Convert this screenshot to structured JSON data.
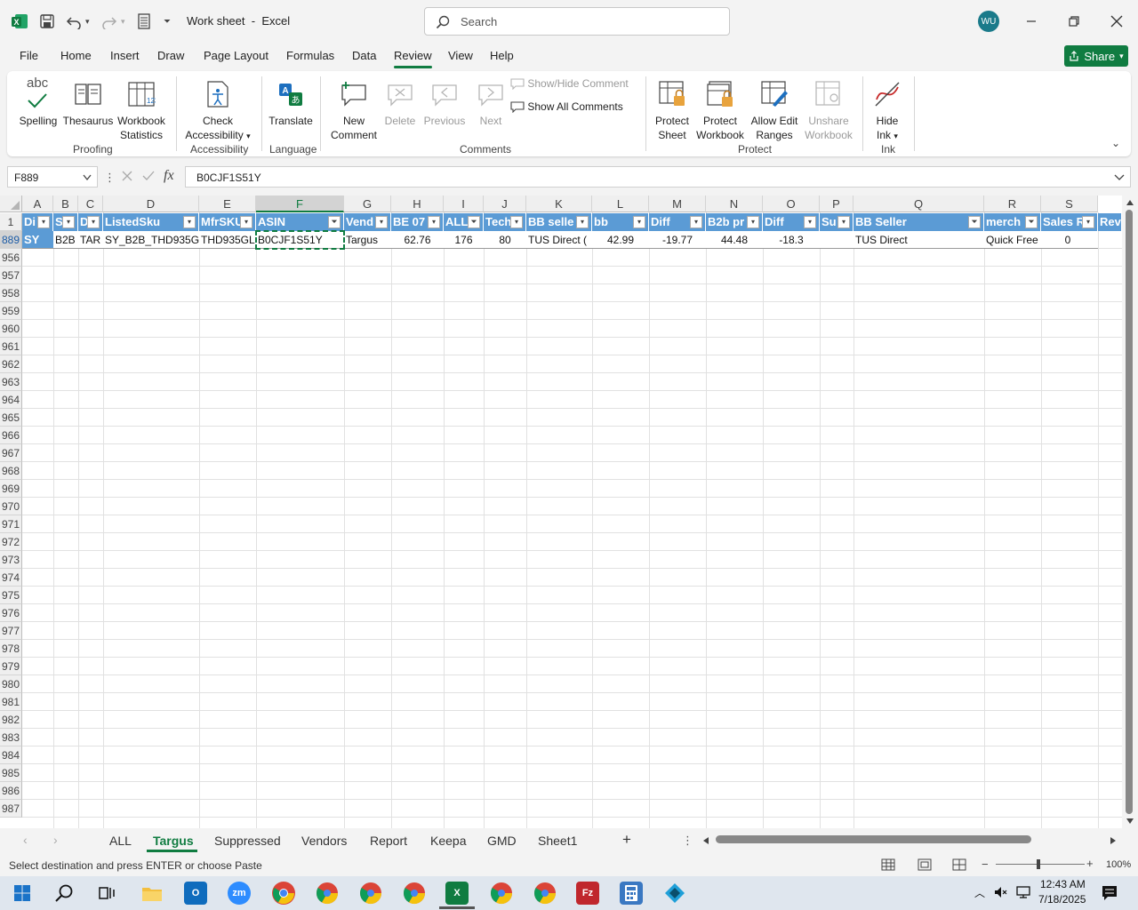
{
  "title_bar": {
    "doc_title": "Work sheet",
    "separator": "-",
    "app_name": "Excel",
    "search_placeholder": "Search",
    "avatar_initials": "WU"
  },
  "menu": {
    "items": [
      "File",
      "Home",
      "Insert",
      "Draw",
      "Page Layout",
      "Formulas",
      "Data",
      "Review",
      "View",
      "Help"
    ],
    "active": "Review",
    "share_label": "Share"
  },
  "ribbon": {
    "proofing": {
      "label": "Proofing",
      "spelling": "Spelling",
      "thesaurus": "Thesaurus",
      "workbook_stats_1": "Workbook",
      "workbook_stats_2": "Statistics",
      "abc": "abc"
    },
    "accessibility": {
      "label": "Accessibility",
      "check_1": "Check",
      "check_2": "Accessibility"
    },
    "language": {
      "label": "Language",
      "translate": "Translate"
    },
    "comments": {
      "label": "Comments",
      "new_1": "New",
      "new_2": "Comment",
      "delete": "Delete",
      "previous": "Previous",
      "next": "Next",
      "show_hide": "Show/Hide Comment",
      "show_all": "Show All Comments"
    },
    "protect": {
      "label": "Protect",
      "sheet_1": "Protect",
      "sheet_2": "Sheet",
      "wb_1": "Protect",
      "wb_2": "Workbook",
      "edit_1": "Allow Edit",
      "edit_2": "Ranges",
      "unshare_1": "Unshare",
      "unshare_2": "Workbook"
    },
    "ink": {
      "label": "Ink",
      "hide_1": "Hide",
      "hide_2": "Ink"
    }
  },
  "formula_bar": {
    "name_box": "F889",
    "fx": "fx",
    "value": "B0CJF1S51Y"
  },
  "grid": {
    "columns": [
      "A",
      "B",
      "C",
      "D",
      "E",
      "F",
      "G",
      "H",
      "I",
      "J",
      "K",
      "L",
      "M",
      "N",
      "O",
      "P",
      "Q",
      "R",
      "S"
    ],
    "selected_column": "F",
    "header_row_number": "1",
    "headers": [
      "Di",
      "S",
      "D",
      "ListedSku",
      "MfrSKU",
      "ASIN",
      "Vend",
      "BE 07",
      "ALL",
      "Tech",
      "BB selle",
      "bb",
      "Diff",
      "B2b pr",
      "Diff",
      "Su",
      "BB Seller",
      "merch",
      "Sales R",
      "Rev"
    ],
    "data_row_number": "889",
    "data_row": [
      "SY",
      "B2B",
      "TAR",
      "SY_B2B_THD935G",
      "THD935GL",
      "B0CJF1S51Y",
      "Targus",
      "62.76",
      "176",
      "80",
      "TUS Direct (",
      "42.99",
      "-19.77",
      "44.48",
      "-18.3",
      "",
      "TUS Direct",
      "Quick Free",
      "0"
    ],
    "empty_rows": [
      "956",
      "957",
      "958",
      "959",
      "960",
      "961",
      "962",
      "963",
      "964",
      "965",
      "966",
      "967",
      "968",
      "969",
      "970",
      "971",
      "972",
      "973",
      "974",
      "975",
      "976",
      "977",
      "978",
      "979",
      "980",
      "981",
      "982",
      "983",
      "984",
      "985",
      "986",
      "987"
    ]
  },
  "sheet_tabs": {
    "tabs": [
      "ALL",
      "Targus",
      "Suppressed",
      "Vendors",
      "Report",
      "Keepa",
      "GMD",
      "Sheet1"
    ],
    "active": "Targus",
    "add": "+"
  },
  "status_bar": {
    "message": "Select destination and press ENTER or choose Paste",
    "zoom": "100%"
  },
  "taskbar": {
    "time": "12:43 AM",
    "date": "7/18/2025"
  },
  "colors": {
    "excel_green": "#107c41",
    "table_header": "#5b9bd5"
  }
}
